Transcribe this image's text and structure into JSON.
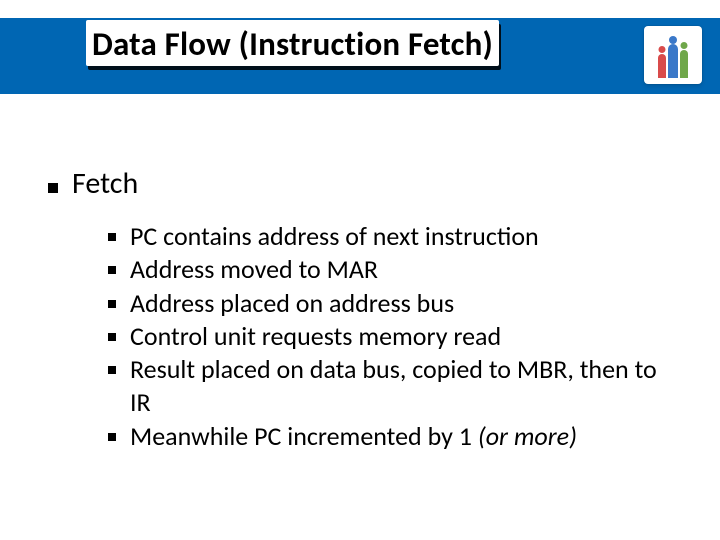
{
  "title": "Data Flow (Instruction Fetch)",
  "section": {
    "heading": "Fetch",
    "items": [
      {
        "text": "PC contains address of next instruction"
      },
      {
        "text": "Address moved to MAR"
      },
      {
        "text": "Address placed on address bus"
      },
      {
        "text": "Control unit requests memory read"
      },
      {
        "text": "Result placed on data bus, copied to MBR, then to IR"
      },
      {
        "text": "Meanwhile PC incremented by 1 ",
        "tail_italic": "(or more)"
      }
    ]
  }
}
